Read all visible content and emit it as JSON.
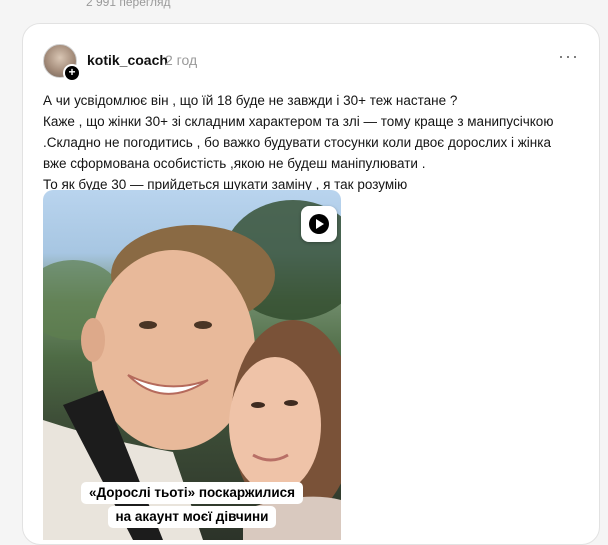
{
  "previous_post": {
    "views": "2 991 перегляд"
  },
  "post": {
    "username": "kotik_coach",
    "time": "2 год",
    "more": "···",
    "text_lines": [
      "А чи усвідомлює він , що їй 18 буде не завжди і 30+ теж настане ?",
      "Каже , що жінки 30+ зі складним характером та злі — тому краще з манипусічкою",
      ".Складно не погодитись , бо важко будувати стосунки коли двоє дорослих і жінка",
      "вже сформована особистість ,якою не будеш маніпулювати .",
      "То як буде 30 — прийдеться шукати заміну , я так розумію"
    ],
    "video": {
      "caption_lines": [
        "«Дорослі тьоті» поскаржилися",
        "на акаунт моєї дівчини"
      ],
      "play_icon": "play-icon"
    }
  }
}
